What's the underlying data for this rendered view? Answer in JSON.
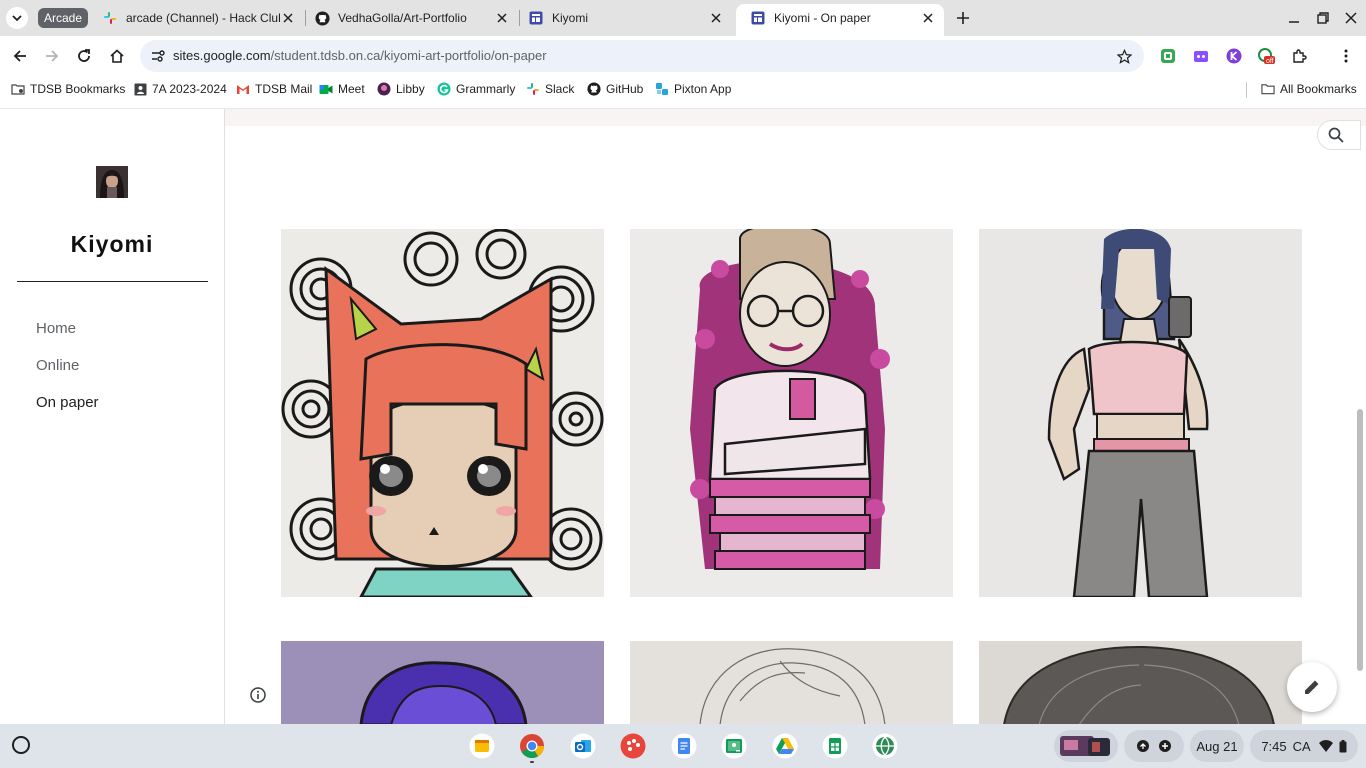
{
  "browser": {
    "tab_group_label": "Arcade",
    "tabs": [
      {
        "title": "arcade (Channel) - Hack Club -",
        "icon": "slack-icon",
        "active": false
      },
      {
        "title": "VedhaGolla/Art-Portfolio",
        "icon": "github-icon",
        "active": false
      },
      {
        "title": "Kiyomi",
        "icon": "google-sites-icon",
        "active": false
      },
      {
        "title": "Kiyomi - On paper",
        "icon": "google-sites-icon",
        "active": true
      }
    ],
    "url_host": "sites.google.com",
    "url_path": "/student.tdsb.on.ca/kiyomi-art-portfolio/on-paper",
    "extension_badge": "off",
    "accent_color": "#0b57d0"
  },
  "bookmarks": {
    "items": [
      {
        "label": "TDSB Bookmarks",
        "icon": "folder-settings-icon"
      },
      {
        "label": "7A 2023-2024",
        "icon": "contact-card-icon"
      },
      {
        "label": "TDSB Mail",
        "icon": "gmail-icon"
      },
      {
        "label": "Meet",
        "icon": "meet-icon"
      },
      {
        "label": "Libby",
        "icon": "libby-icon"
      },
      {
        "label": "Grammarly",
        "icon": "grammarly-icon"
      },
      {
        "label": "Slack",
        "icon": "slack-icon"
      },
      {
        "label": "GitHub",
        "icon": "github-icon"
      },
      {
        "label": "Pixton App",
        "icon": "pixton-icon"
      }
    ],
    "all_bookmarks": "All Bookmarks"
  },
  "site": {
    "title": "Kiyomi",
    "nav": [
      {
        "label": "Home",
        "current": false
      },
      {
        "label": "Online",
        "current": false
      },
      {
        "label": "On paper",
        "current": true
      }
    ]
  },
  "gallery": {
    "images": [
      "cat-ear anime girl with red hair on swirl background",
      "girl with glasses hugging knees, purple flower border",
      "girl in pink crop top taking mirror selfie",
      "purple-haired drawing (partially visible)",
      "pencil sketch of hair (partially visible)",
      "pencil sketch of dark hair (partially visible)"
    ]
  },
  "shelf": {
    "apps": [
      "sticky-notes-icon",
      "chrome-icon",
      "outlook-icon",
      "paint-icon",
      "docs-icon",
      "classroom-icon",
      "drive-icon",
      "sheets-icon",
      "globe-icon"
    ],
    "date": "Aug 21",
    "time": "7:45",
    "locale": "CA"
  }
}
